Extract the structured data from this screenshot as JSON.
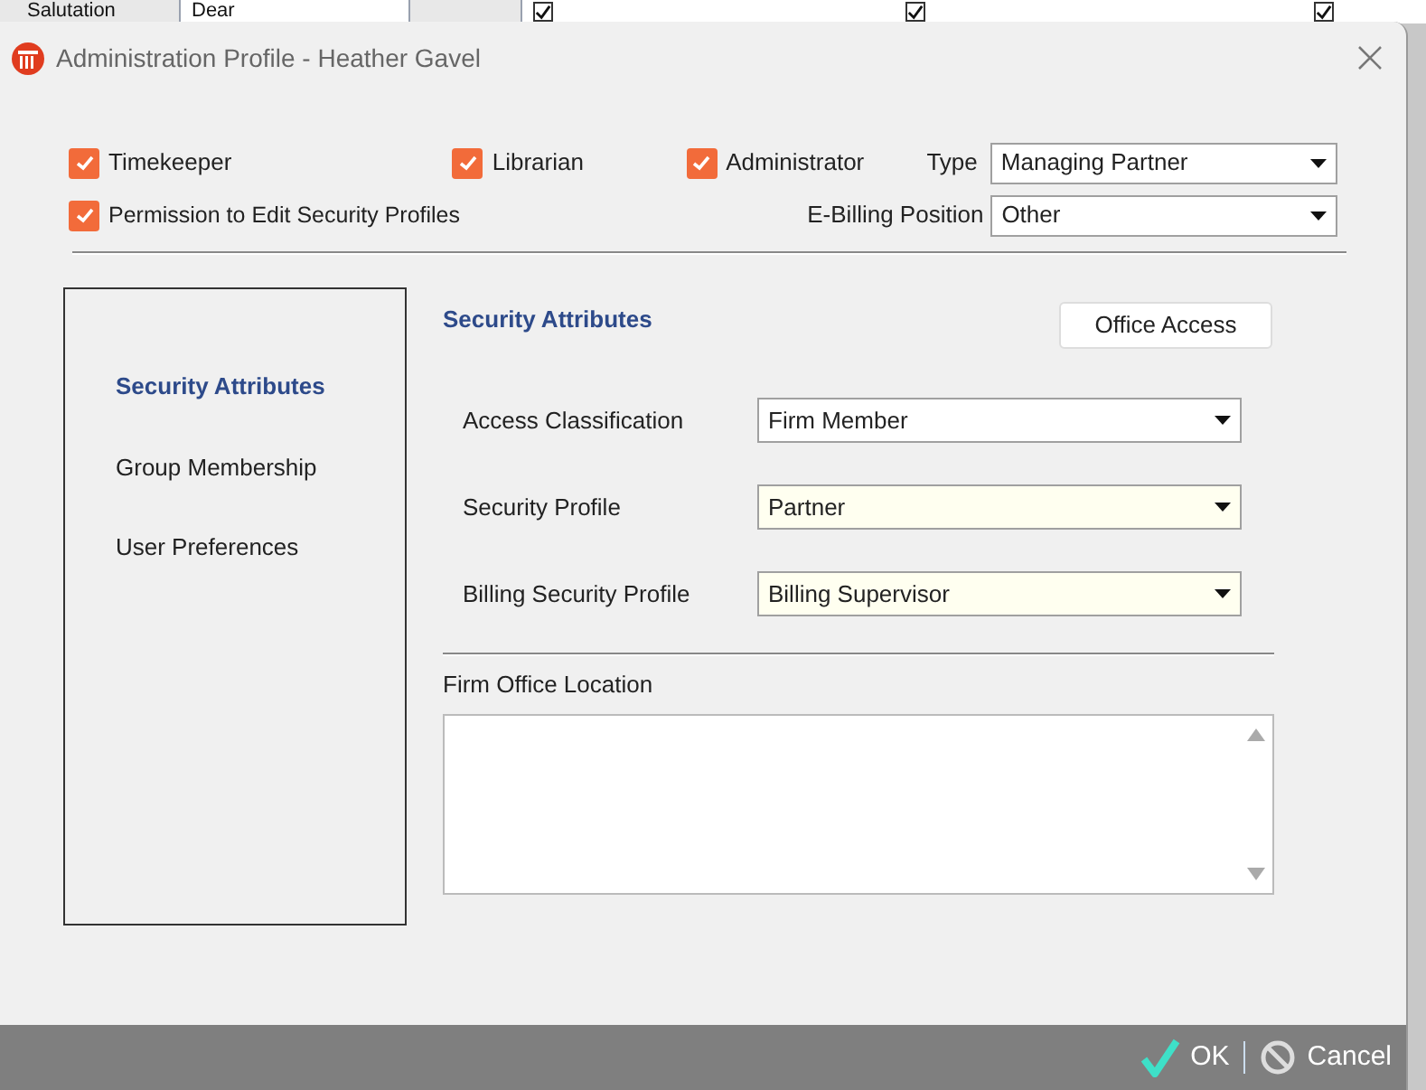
{
  "background_table": {
    "cells": [
      "Salutation",
      "Dear"
    ],
    "checkboxes": [
      {
        "checked": true
      },
      {
        "checked": true
      },
      {
        "checked": true
      }
    ]
  },
  "window": {
    "title": "Administration Profile - Heather Gavel"
  },
  "flags": [
    {
      "label": "Timekeeper",
      "checked": true
    },
    {
      "label": "Librarian",
      "checked": true
    },
    {
      "label": "Administrator",
      "checked": true
    },
    {
      "label": "Permission to Edit Security Profiles",
      "checked": true
    }
  ],
  "type": {
    "label": "Type",
    "value": "Managing Partner"
  },
  "ebilling_position": {
    "label": "E-Billing Position",
    "value": "Other"
  },
  "nav": [
    {
      "label": "Security Attributes",
      "selected": true
    },
    {
      "label": "Group Membership",
      "selected": false
    },
    {
      "label": "User Preferences",
      "selected": false
    }
  ],
  "section": {
    "title": "Security Attributes",
    "button": "Office Access",
    "fields": [
      {
        "label": "Access Classification",
        "value": "Firm Member",
        "required": false
      },
      {
        "label": "Security Profile",
        "value": "Partner",
        "required": true
      },
      {
        "label": "Billing Security Profile",
        "value": "Billing Supervisor",
        "required": true
      }
    ],
    "location_label": "Firm Office Location"
  },
  "footer": {
    "ok": "OK",
    "cancel": "Cancel"
  }
}
